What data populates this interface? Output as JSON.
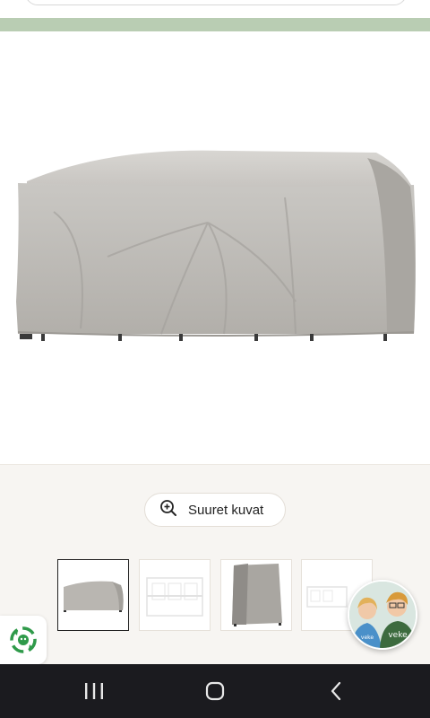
{
  "banner": {
    "text": ""
  },
  "gallery": {
    "zoom_label": "Suuret kuvat",
    "thumbnails": [
      "table-cover-front",
      "garden-furniture-set",
      "table-cover-side",
      "garden-furniture-set-2"
    ]
  },
  "avatar": {
    "shirt_text": "veke",
    "shirt_text_left": "veke"
  },
  "colors": {
    "banner": "#b9cdb3",
    "navbar": "#1b1b1f",
    "eco_green": "#2f9a4a"
  }
}
